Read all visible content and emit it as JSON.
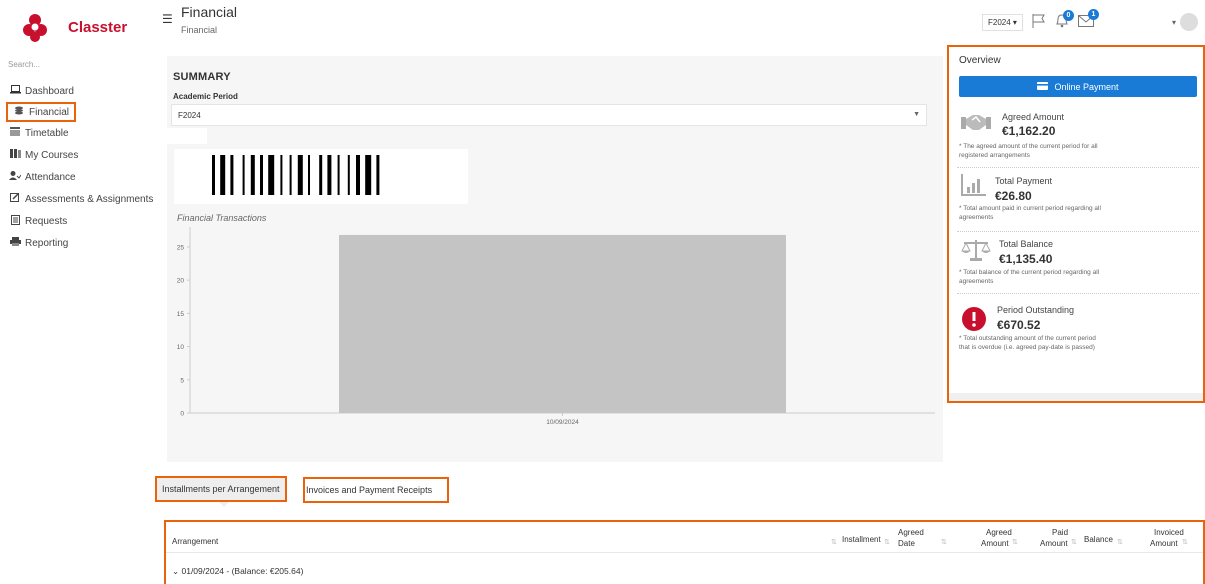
{
  "app": {
    "name": "Classter",
    "search_placeholder": "Search..."
  },
  "sidebar": {
    "items": [
      {
        "label": "Dashboard",
        "icon": "laptop-icon"
      },
      {
        "label": "Financial",
        "icon": "coins-icon",
        "active": true
      },
      {
        "label": "Timetable",
        "icon": "calendar-icon"
      },
      {
        "label": "My Courses",
        "icon": "books-icon"
      },
      {
        "label": "Attendance",
        "icon": "user-check-icon"
      },
      {
        "label": "Assessments & Assignments",
        "icon": "edit-icon"
      },
      {
        "label": "Requests",
        "icon": "document-icon"
      },
      {
        "label": "Reporting",
        "icon": "printer-icon"
      }
    ]
  },
  "header": {
    "title": "Financial",
    "breadcrumb": "Financial",
    "period": "F2024 ▾",
    "notifications_count": "0",
    "messages_count": "1"
  },
  "summary": {
    "title": "SUMMARY",
    "academic_period_label": "Academic Period",
    "academic_period_value": "F2024",
    "transactions_title": "Financial Transactions"
  },
  "chart_data": {
    "type": "bar",
    "categories": [
      "10/09/2024"
    ],
    "values": [
      26.8
    ],
    "title": "Financial Transactions",
    "ylim": [
      0,
      28
    ],
    "yticks": [
      0,
      5,
      10,
      15,
      20,
      25
    ],
    "color": "#c4c4c4",
    "grid": false
  },
  "overview": {
    "title": "Overview",
    "pay_button": "Online Payment",
    "agreed": {
      "label": "Agreed Amount",
      "value": "€1,162.20",
      "note": "* The agreed amount of the current period for all registered arrangements"
    },
    "payment": {
      "label": "Total Payment",
      "value": "€26.80",
      "note": "* Total amount paid in current period regarding all agreements"
    },
    "balance": {
      "label": "Total Balance",
      "value": "€1,135.40",
      "note": "* Total balance of the current period regarding all agreements"
    },
    "outstanding": {
      "label": "Period Outstanding",
      "value": "€670.52",
      "note": "* Total outstanding amount of the current period that is overdue (i.e. agreed pay-date is passed)"
    }
  },
  "tabs": [
    {
      "label": "Installments per Arrangement",
      "active": true
    },
    {
      "label": "Invoices and Payment Receipts"
    }
  ],
  "table": {
    "columns": {
      "arrangement": "Arrangement",
      "installment": "Installment",
      "agreed_date_1": "Agreed",
      "agreed_date_2": "Date",
      "agreed_amount_1": "Agreed",
      "agreed_amount_2": "Amount",
      "paid_amount_1": "Paid",
      "paid_amount_2": "Amount",
      "balance": "Balance",
      "invoiced_amount_1": "Invoiced",
      "invoiced_amount_2": "Amount"
    },
    "groups": [
      {
        "label": "⌄ 01/09/2024 - (Balance: €205.64)"
      }
    ]
  },
  "colors": {
    "brand": "#c8102e",
    "accent": "#1a7bd6",
    "highlight": "#e8630a",
    "bar": "#c4c4c4"
  }
}
